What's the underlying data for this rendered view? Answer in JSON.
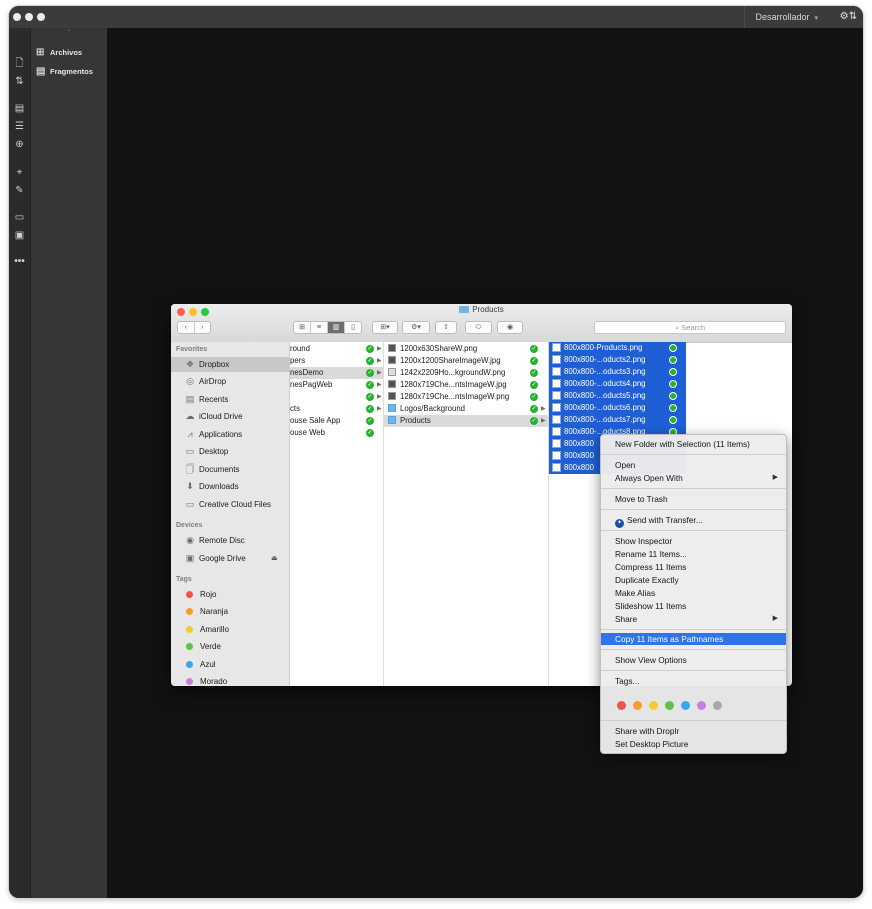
{
  "app": {
    "workspace": "Desarrollador"
  },
  "panel": {
    "items": [
      {
        "label": "Archivos",
        "icon": "sitemap-icon"
      },
      {
        "label": "Fragmentos",
        "icon": "snippet-icon"
      }
    ]
  },
  "finder": {
    "window_title": "Products",
    "search_placeholder": "Search",
    "sidebar": {
      "favorites_header": "Favorites",
      "favorites": [
        "Dropbox",
        "AirDrop",
        "Recents",
        "iCloud Drive",
        "Applications",
        "Desktop",
        "Documents",
        "Downloads",
        "Creative Cloud Files"
      ],
      "devices_header": "Devices",
      "devices": [
        "Remote Disc",
        "Google Drive"
      ],
      "tags_header": "Tags",
      "tags": [
        {
          "label": "Rojo",
          "color": "#f0524f"
        },
        {
          "label": "Naranja",
          "color": "#f59c34"
        },
        {
          "label": "Amarillo",
          "color": "#f3cc2f"
        },
        {
          "label": "Verde",
          "color": "#5fc24b"
        },
        {
          "label": "Azul",
          "color": "#3aa6ec"
        },
        {
          "label": "Morado",
          "color": "#c67fe3"
        }
      ]
    },
    "column1": [
      "round",
      "pers",
      "nesDemo",
      "nesPagWeb",
      "",
      "cts",
      "ouse Sale App",
      "ouse Web"
    ],
    "column2": [
      "1200x630ShareW.png",
      "1200x1200ShareImageW.jpg",
      "1242x2209Ho...kgroundW.png",
      "1280x719Che...ntsImageW.jpg",
      "1280x719Che...ntsImageW.png",
      "Logos/Background",
      "Products"
    ],
    "column3": [
      "800x800-Products.png",
      "800x800-...oducts2.png",
      "800x800-...oducts3.png",
      "800x800-...oducts4.png",
      "800x800-...oducts5.png",
      "800x800-...oducts6.png",
      "800x800-...oducts7.png",
      "800x800-...oducts8.png",
      "800x800",
      "800x800",
      "800x800"
    ]
  },
  "context_menu": {
    "new_folder": "New Folder with Selection (11 Items)",
    "open": "Open",
    "always_open_with": "Always Open With",
    "move_to_trash": "Move to Trash",
    "send_with_transfer": "Send with Transfer...",
    "show_inspector": "Show Inspector",
    "rename": "Rename 11 Items...",
    "compress": "Compress 11 Items",
    "duplicate": "Duplicate Exactly",
    "make_alias": "Make Alias",
    "slideshow": "Slideshow 11 Items",
    "share": "Share",
    "copy_pathnames": "Copy 11 Items as Pathnames",
    "show_view_options": "Show View Options",
    "tags": "Tags...",
    "tag_colors": [
      "#f0524f",
      "#f59c34",
      "#f3cc2f",
      "#5fc24b",
      "#3aa6ec",
      "#c67fe3",
      "#a8a8a8"
    ],
    "share_droplr": "Share with Droplr",
    "set_desktop": "Set Desktop Picture"
  }
}
